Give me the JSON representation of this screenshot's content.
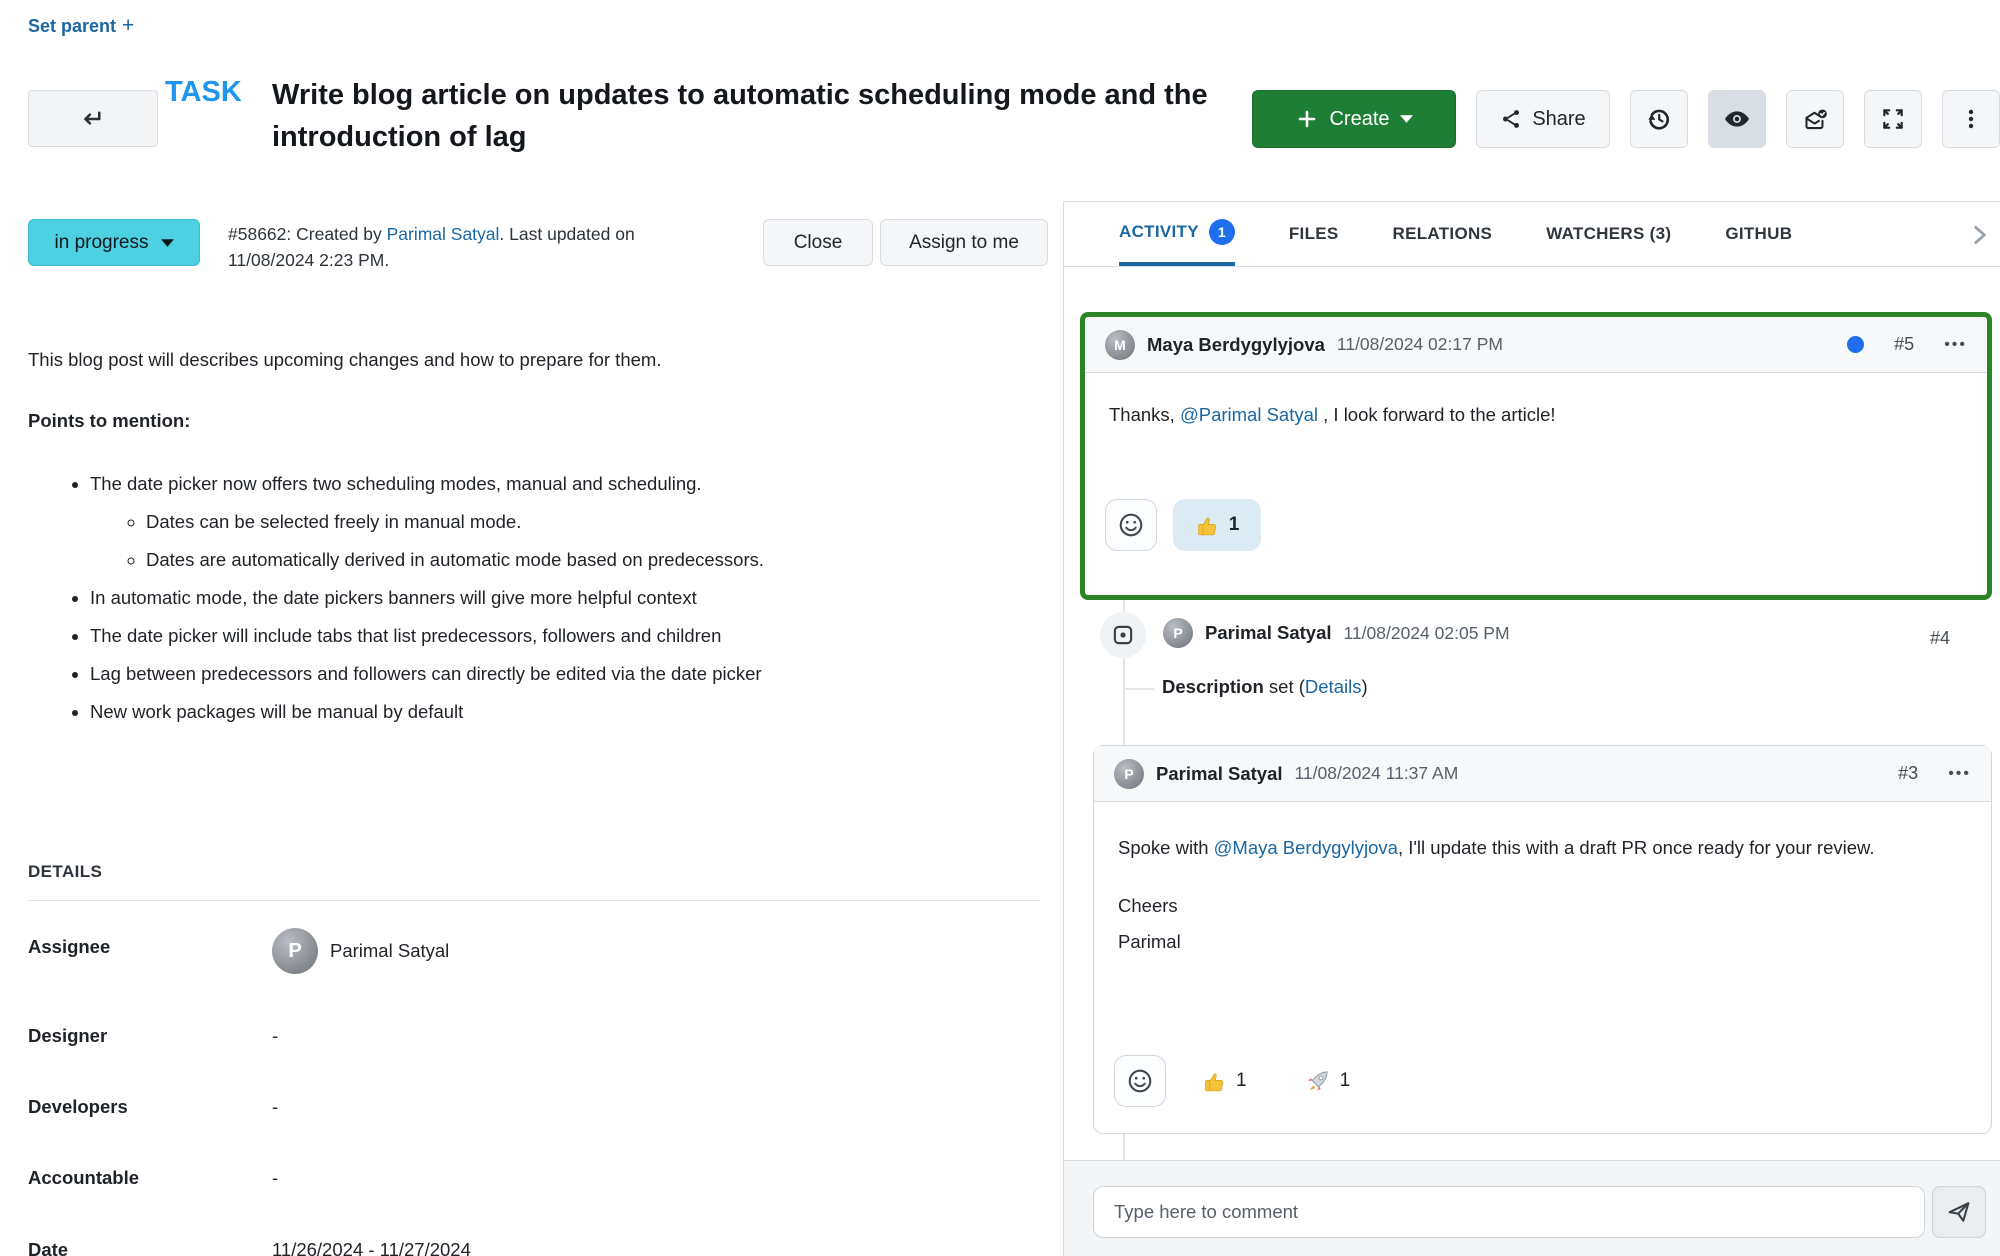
{
  "page": {
    "set_parent": "Set parent"
  },
  "header": {
    "type_label": "TASK",
    "title": "Write blog article on updates to automatic scheduling mode and the introduction of lag",
    "create_label": "Create",
    "share_label": "Share"
  },
  "status_bar": {
    "status_label": "in progress",
    "meta_prefix": "#58662: Created by ",
    "creator": "Parimal Satyal",
    "meta_suffix": ". Last updated on 11/08/2024 2:23 PM.",
    "close_label": "Close",
    "assign_label": "Assign to me"
  },
  "description": {
    "intro": "This blog post will describes upcoming changes and how to prepare for them.",
    "heading": "Points to mention:",
    "bullets": [
      {
        "text": "The date picker now offers two scheduling modes, manual and scheduling."
      },
      {
        "sub": true,
        "text": "Dates can be selected freely in manual mode."
      },
      {
        "sub": true,
        "text": "Dates are automatically derived in automatic mode based on predecessors."
      },
      {
        "text": "In automatic mode, the date pickers banners will give more helpful context"
      },
      {
        "text": "The date picker will include tabs that list predecessors, followers and children"
      },
      {
        "text": "Lag between predecessors and followers can directly be edited via the date picker"
      },
      {
        "text": "New work packages will be manual by default"
      }
    ]
  },
  "details": {
    "heading": "DETAILS",
    "assignee_label": "Assignee",
    "assignee_value": "Parimal Satyal",
    "assignee_initial": "P",
    "designer_label": "Designer",
    "designer_value": "-",
    "developers_label": "Developers",
    "developers_value": "-",
    "accountable_label": "Accountable",
    "accountable_value": "-",
    "date_label": "Date",
    "date_value": "11/26/2024 - 11/27/2024"
  },
  "tabs": {
    "activity": "ACTIVITY",
    "activity_badge": "1",
    "files": "FILES",
    "relations": "RELATIONS",
    "watchers": "WATCHERS (3)",
    "github": "GITHUB"
  },
  "activity": {
    "comment5": {
      "author": "Maya Berdygylyjova",
      "author_initial": "M",
      "timestamp": "11/08/2024 02:17 PM",
      "id": "#5",
      "menu": "•••",
      "body_prefix": "Thanks, ",
      "mention": "@Parimal Satyal",
      "body_suffix": " , I look forward to the article!",
      "thumb_count": "1"
    },
    "event4": {
      "author": "Parimal Satyal",
      "author_initial": "P",
      "timestamp": "11/08/2024 02:05 PM",
      "id": "#4",
      "change_field": "Description",
      "change_text": " set (",
      "change_link": "Details",
      "change_end": ")"
    },
    "comment3": {
      "author": "Parimal Satyal",
      "author_initial": "P",
      "timestamp": "11/08/2024 11:37 AM",
      "id": "#3",
      "menu": "•••",
      "body_prefix": "Spoke with ",
      "mention": "@Maya Berdygylyjova",
      "body_suffix": ", I'll update this with a draft PR once ready for your review.",
      "signoff_line1": "Cheers",
      "signoff_line2": "Parimal",
      "thumb_count": "1",
      "rocket_count": "1"
    },
    "composer_placeholder": "Type here to comment"
  },
  "colors": {
    "create_green": "#1e7e34",
    "status_cyan": "#4dd0e1",
    "link_blue": "#1a67a3",
    "badge_blue": "#1f6feb",
    "selection_green": "#2d8328",
    "type_blue": "#1e96f0"
  }
}
